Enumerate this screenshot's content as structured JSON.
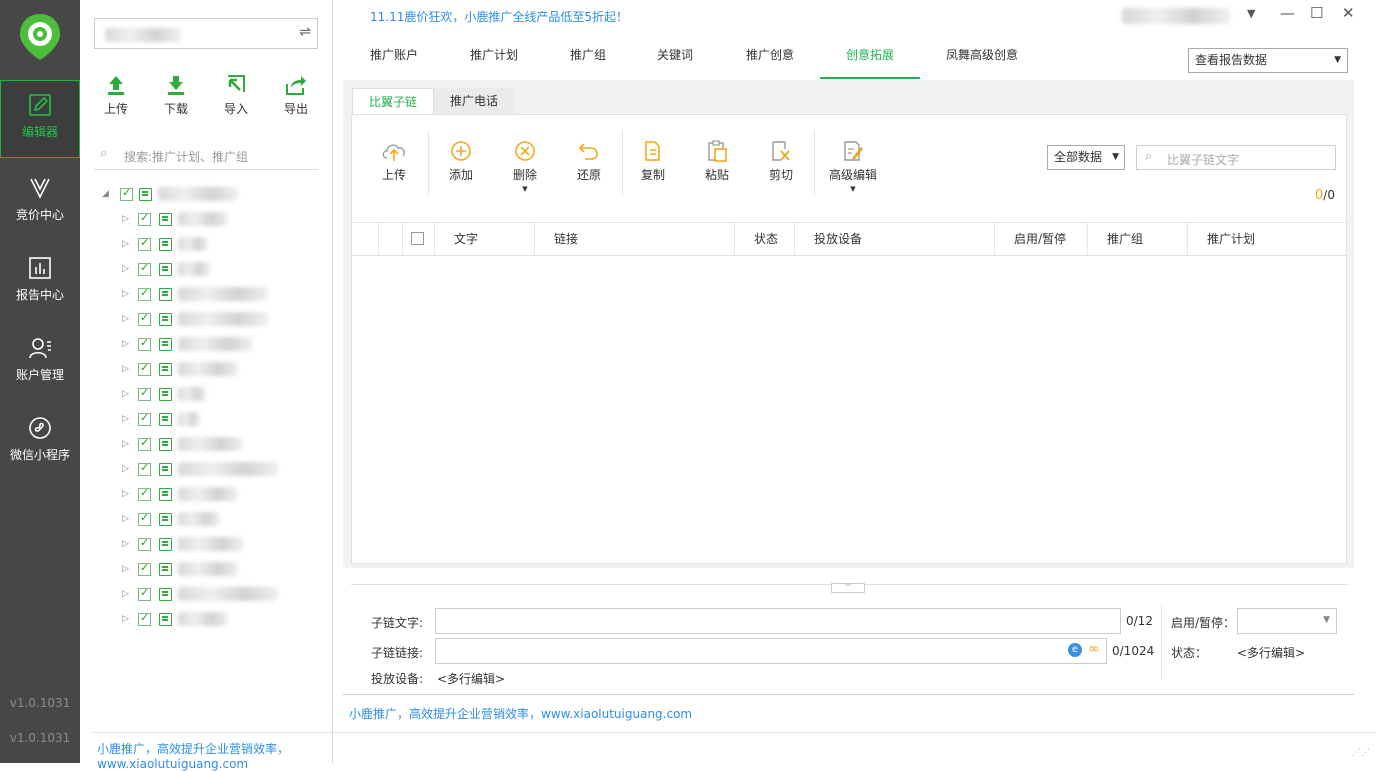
{
  "promo": "11.11鹿价狂欢，小鹿推广全线产品低至5折起！",
  "window": {
    "dropdown_icon": "▼",
    "minimize_icon": "—",
    "maximize_icon": "☐",
    "close_icon": "✕"
  },
  "nav": {
    "items": [
      {
        "label": "编辑器",
        "icon": "pencil-icon",
        "active": true
      },
      {
        "label": "竞价中心",
        "icon": "funnel-icon",
        "active": false
      },
      {
        "label": "报告中心",
        "icon": "chart-icon",
        "active": false
      },
      {
        "label": "账户管理",
        "icon": "user-icon",
        "active": false
      },
      {
        "label": "微信小程序",
        "icon": "miniprogram-icon",
        "active": false
      }
    ],
    "version_1": "v1.0.1031",
    "version_2": "v1.0.1031"
  },
  "tree_panel": {
    "switch_icon": "⇌",
    "tools": [
      {
        "label": "上传",
        "icon": "upload-icon"
      },
      {
        "label": "下载",
        "icon": "download-icon"
      },
      {
        "label": "导入",
        "icon": "import-icon"
      },
      {
        "label": "导出",
        "icon": "export-icon"
      }
    ],
    "search_placeholder": "搜索:推广计划、推广组",
    "footer": "小鹿推广，高效提升企业营销效率，www.xiaolutuiguang.com"
  },
  "tabs": [
    "推广账户",
    "推广计划",
    "推广组",
    "关键词",
    "推广创意",
    "创意拓展",
    "凤舞高级创意"
  ],
  "active_tab": "创意拓展",
  "report_select": "查看报告数据",
  "subtabs": [
    "比翼子链",
    "推广电话"
  ],
  "toolbar": [
    {
      "label": "上传",
      "icon": "cloud-upload-icon"
    },
    {
      "label": "添加",
      "icon": "add-icon"
    },
    {
      "label": "删除",
      "icon": "delete-icon"
    },
    {
      "label": "还原",
      "icon": "undo-icon"
    },
    {
      "label": "复制",
      "icon": "copy-icon"
    },
    {
      "label": "粘贴",
      "icon": "paste-icon"
    },
    {
      "label": "剪切",
      "icon": "cut-icon"
    },
    {
      "label": "高级编辑",
      "icon": "advanced-edit-icon"
    }
  ],
  "filter_select": "全部数据",
  "search_placeholder": "比翼子链文字",
  "count_selected": "0",
  "count_total": "/0",
  "table_headers": [
    "文字",
    "链接",
    "状态",
    "投放设备",
    "启用/暂停",
    "推广组",
    "推广计划"
  ],
  "form": {
    "text_label": "子链文字:",
    "text_value": "",
    "text_counter": "0/12",
    "link_label": "子链链接:",
    "link_value": "",
    "link_counter": "0/1024",
    "device_label": "投放设备:",
    "device_value": "<多行编辑>",
    "enable_label": "启用/暂停：",
    "status_label": "状态：",
    "status_value": "<多行编辑>"
  },
  "main_footer": "小鹿推广，高效提升企业营销效率，www.xiaolutuiguang.com",
  "colors": {
    "accent_green": "#22b24c",
    "link_blue": "#2d8de6",
    "nav_bg": "#474747"
  }
}
